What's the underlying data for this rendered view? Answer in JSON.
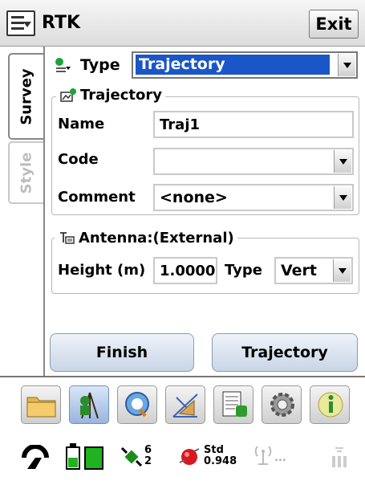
{
  "titlebar": {
    "title": "RTK",
    "exit_label": "Exit"
  },
  "tabs": [
    {
      "label": "Survey",
      "active": true
    },
    {
      "label": "Style",
      "active": false
    }
  ],
  "type_field": {
    "label": "Type",
    "value": "Trajectory"
  },
  "trajectory_group": {
    "title": "Trajectory",
    "name_label": "Name",
    "name_value": "Traj1",
    "code_label": "Code",
    "code_value": "",
    "comment_label": "Comment",
    "comment_value": "<none>"
  },
  "antenna_group": {
    "title": "Antenna:(External)",
    "height_label": "Height (m)",
    "height_value": "1.0000",
    "type_label": "Type",
    "type_value": "Vert"
  },
  "actions": {
    "finish_label": "Finish",
    "trajectory_label": "Trajectory"
  },
  "toolbar": {
    "icons": [
      "folder-icon",
      "survey-icon",
      "view-icon",
      "cogo-icon",
      "data-icon",
      "settings-icon",
      "info-icon"
    ]
  },
  "status": {
    "satellites_top": "6",
    "satellites_bottom": "2",
    "solution_type": "Std",
    "solution_value": "0.948",
    "radio_text": "..."
  },
  "colors": {
    "accent": "#1a56c8",
    "battery": "#1fb31f",
    "gnss": "#d8181f"
  }
}
